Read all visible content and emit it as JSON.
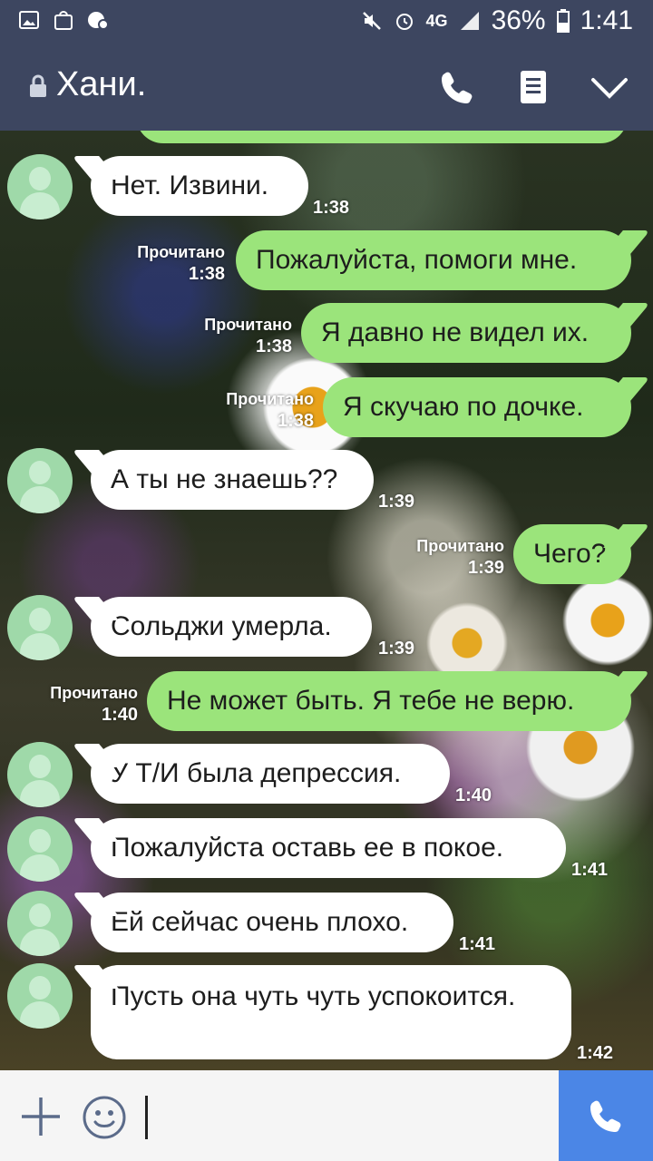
{
  "status_bar": {
    "battery": "36%",
    "time": "1:41",
    "network": "4G",
    "icons": [
      "gallery-icon",
      "shopping-bag-icon",
      "wifi-voice-icon",
      "mute-icon",
      "alarm-icon",
      "signal-icon",
      "battery-icon"
    ]
  },
  "header": {
    "title": "Хани.",
    "icons": [
      "lock-icon",
      "phone-icon",
      "notes-icon",
      "chevron-down-icon"
    ]
  },
  "messages": [
    {
      "side": "in",
      "text": "Нет. Извини.",
      "time": "1:38"
    },
    {
      "side": "out",
      "text": "Пожалуйста, помоги мне.",
      "read": "Прочитано",
      "time": "1:38"
    },
    {
      "side": "out",
      "text": "Я давно не видел их.",
      "read": "Прочитано",
      "time": "1:38"
    },
    {
      "side": "out",
      "text": "Я скучаю по дочке.",
      "read": "Прочитано",
      "time": "1:38"
    },
    {
      "side": "in",
      "text": "А ты не знаешь??",
      "time": "1:39"
    },
    {
      "side": "out",
      "text": "Чего?",
      "read": "Прочитано",
      "time": "1:39"
    },
    {
      "side": "in",
      "text": "Сольджи умерла.",
      "time": "1:39"
    },
    {
      "side": "out",
      "text": "Не может быть. Я тебе не верю.",
      "read": "Прочитано",
      "time": "1:40"
    },
    {
      "side": "in",
      "text": "У Т/И была депрессия.",
      "time": "1:40"
    },
    {
      "side": "in",
      "text": "Пожалуйста оставь ее в покое.",
      "time": "1:41"
    },
    {
      "side": "in",
      "text": "Ей сейчас очень плохо.",
      "time": "1:41"
    },
    {
      "side": "in",
      "text": "Пусть она чуть чуть успокоится.",
      "time": "1:42"
    }
  ],
  "input": {
    "icons": [
      "plus-icon",
      "emoji-icon",
      "call-icon"
    ]
  },
  "colors": {
    "header_bg": "#3d4660",
    "outgoing_bubble": "#9be47b",
    "incoming_bubble": "#ffffff",
    "call_button": "#4b86e6"
  }
}
